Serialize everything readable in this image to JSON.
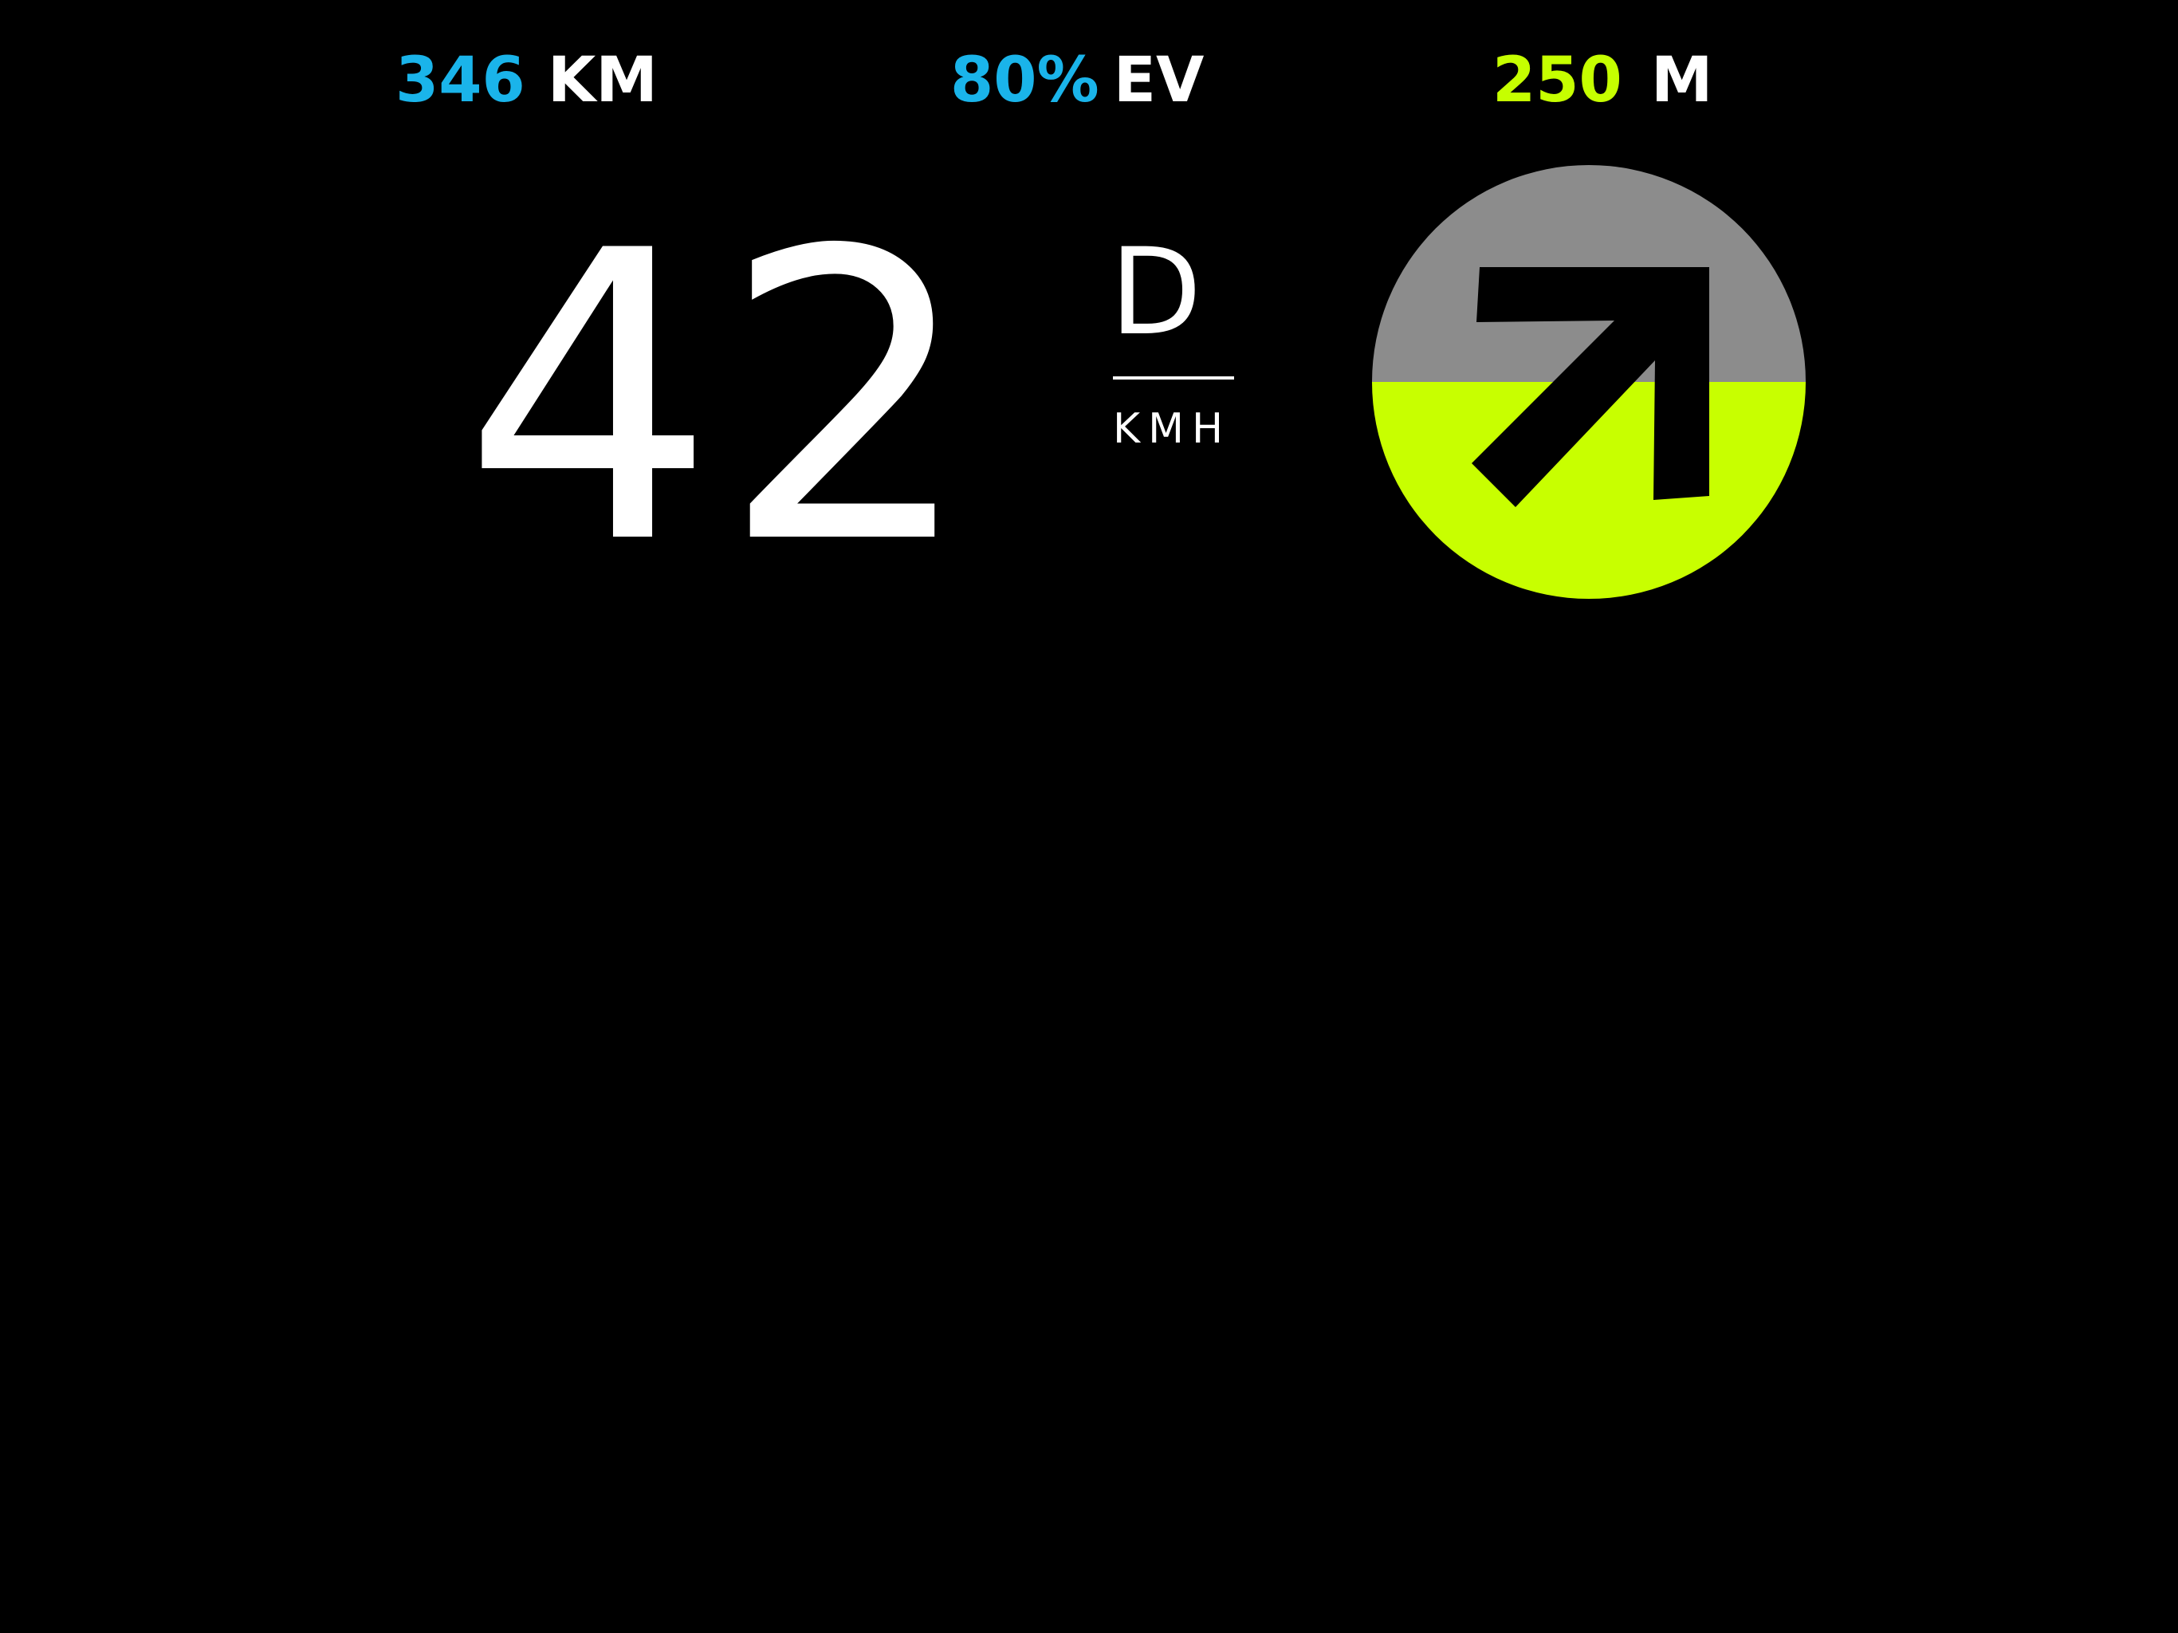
{
  "status_bar": {
    "range": {
      "value": "346",
      "unit": "KM",
      "value_color": "#1ab4ea"
    },
    "battery": {
      "value": "80%",
      "unit": "EV",
      "value_color": "#1ab4ea"
    },
    "next_turn_distance": {
      "value": "250",
      "unit": "M",
      "value_color": "#c6ff00"
    }
  },
  "speedometer": {
    "speed": "42",
    "gear": "D",
    "unit": "KMH"
  },
  "navigation": {
    "direction_icon": "arrow-up-right-icon",
    "colors": {
      "upper": "#8c8c8c",
      "lower": "#c8ff00",
      "arrow": "#000000"
    }
  }
}
